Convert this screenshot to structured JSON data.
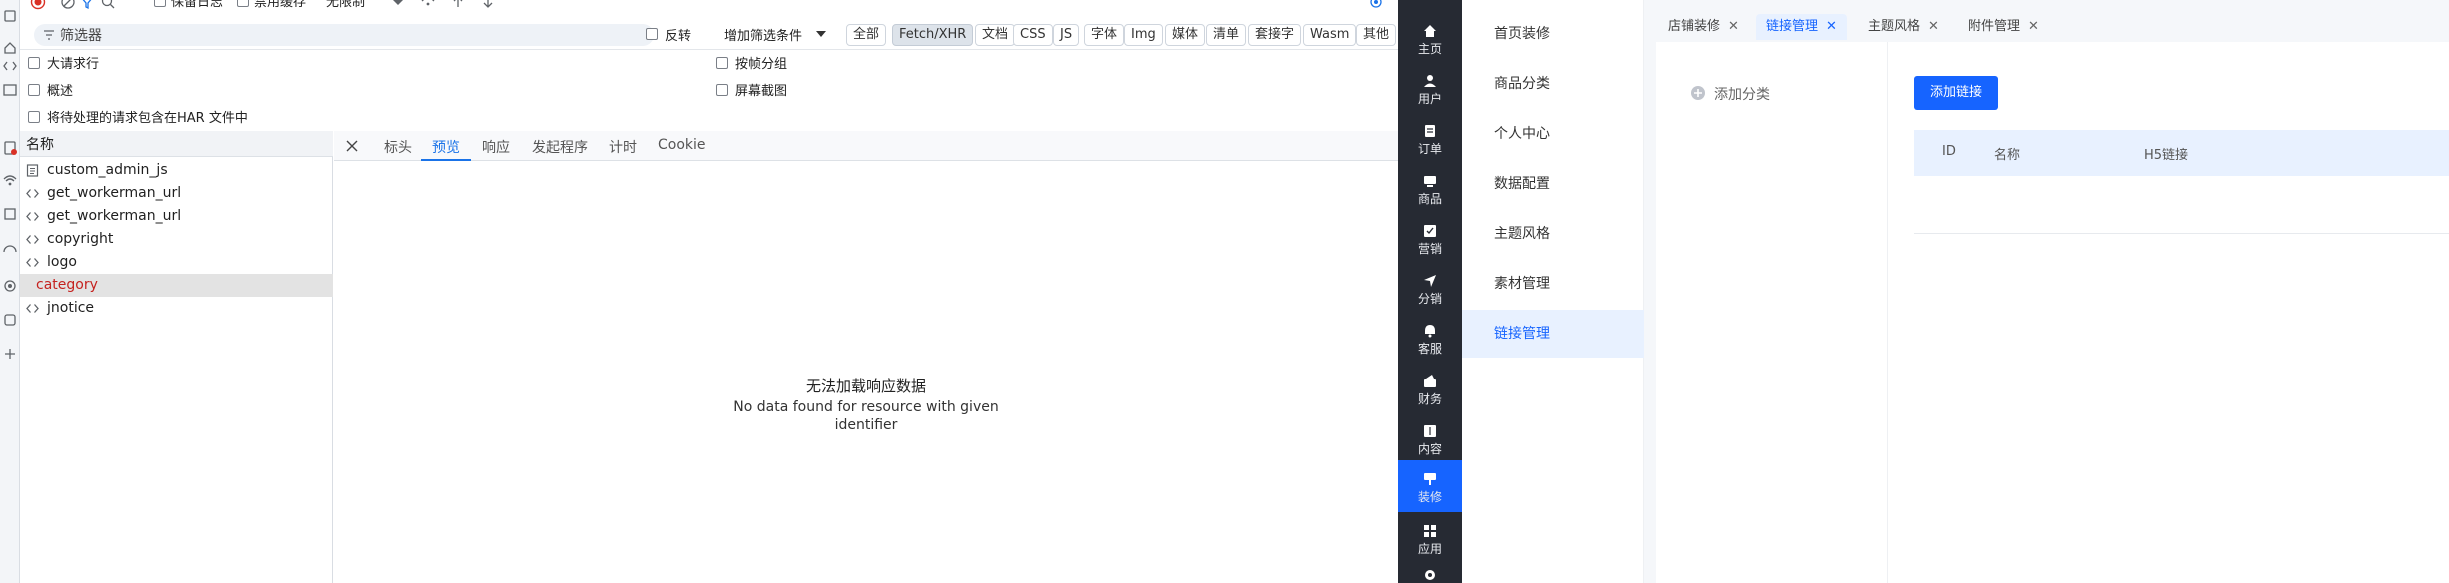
{
  "devtools": {
    "toolbar": {
      "preserve_log": "保留日志",
      "disable_cache": "禁用缓存",
      "throttling": "无限制"
    },
    "filter": {
      "placeholder": "筛选器",
      "invert": "反转",
      "more_filters": "增加筛选条件",
      "type_chips": [
        "全部",
        "Fetch/XHR",
        "文档",
        "CSS",
        "JS",
        "字体",
        "Img",
        "媒体",
        "清单",
        "套接字",
        "Wasm",
        "其他"
      ],
      "active_chip": "Fetch/XHR"
    },
    "options": {
      "big_request_rows": "大请求行",
      "overview": "概述",
      "har_pending": "将待处理的请求包含在HAR 文件中",
      "group_by_frame": "按帧分组",
      "screenshots": "屏幕截图"
    },
    "request_list": {
      "header": "名称",
      "rows": [
        {
          "name": "custom_admin_js",
          "icon": "document-icon",
          "selected": false
        },
        {
          "name": "get_workerman_url",
          "icon": "xhr-icon",
          "selected": false
        },
        {
          "name": "get_workerman_url",
          "icon": "xhr-icon",
          "selected": false
        },
        {
          "name": "copyright",
          "icon": "xhr-icon",
          "selected": false
        },
        {
          "name": "logo",
          "icon": "xhr-icon",
          "selected": false
        },
        {
          "name": "category",
          "icon": "",
          "selected": true
        },
        {
          "name": "jnotice",
          "icon": "xhr-icon",
          "selected": false
        }
      ],
      "selected_color": "#c5221f"
    },
    "detail": {
      "tabs": [
        "标头",
        "预览",
        "响应",
        "发起程序",
        "计时",
        "Cookie"
      ],
      "active_tab": "预览",
      "message_title": "无法加载响应数据",
      "message_line1": "No data found for resource with given",
      "message_line2": "identifier"
    }
  },
  "app": {
    "rail": {
      "items": [
        {
          "label": "主页",
          "icon": "home-icon"
        },
        {
          "label": "用户",
          "icon": "user-icon"
        },
        {
          "label": "订单",
          "icon": "order-icon"
        },
        {
          "label": "商品",
          "icon": "goods-icon"
        },
        {
          "label": "营销",
          "icon": "marketing-icon"
        },
        {
          "label": "分销",
          "icon": "distribution-icon"
        },
        {
          "label": "客服",
          "icon": "service-icon"
        },
        {
          "label": "财务",
          "icon": "finance-icon"
        },
        {
          "label": "内容",
          "icon": "content-icon"
        },
        {
          "label": "装修",
          "icon": "decorate-icon"
        },
        {
          "label": "应用",
          "icon": "apps-icon"
        }
      ],
      "active": "装修",
      "accent": "#1664ff"
    },
    "submenu": {
      "items": [
        "首页装修",
        "商品分类",
        "个人中心",
        "数据配置",
        "主题风格",
        "素材管理",
        "链接管理"
      ],
      "active": "链接管理"
    },
    "page_tabs": [
      {
        "label": "店铺装修",
        "active": false
      },
      {
        "label": "链接管理",
        "active": true
      },
      {
        "label": "主题风格",
        "active": false
      },
      {
        "label": "附件管理",
        "active": false
      }
    ],
    "content": {
      "add_category": "添加分类",
      "add_link_button": "添加链接",
      "table_columns": [
        "ID",
        "名称",
        "H5链接"
      ]
    }
  }
}
